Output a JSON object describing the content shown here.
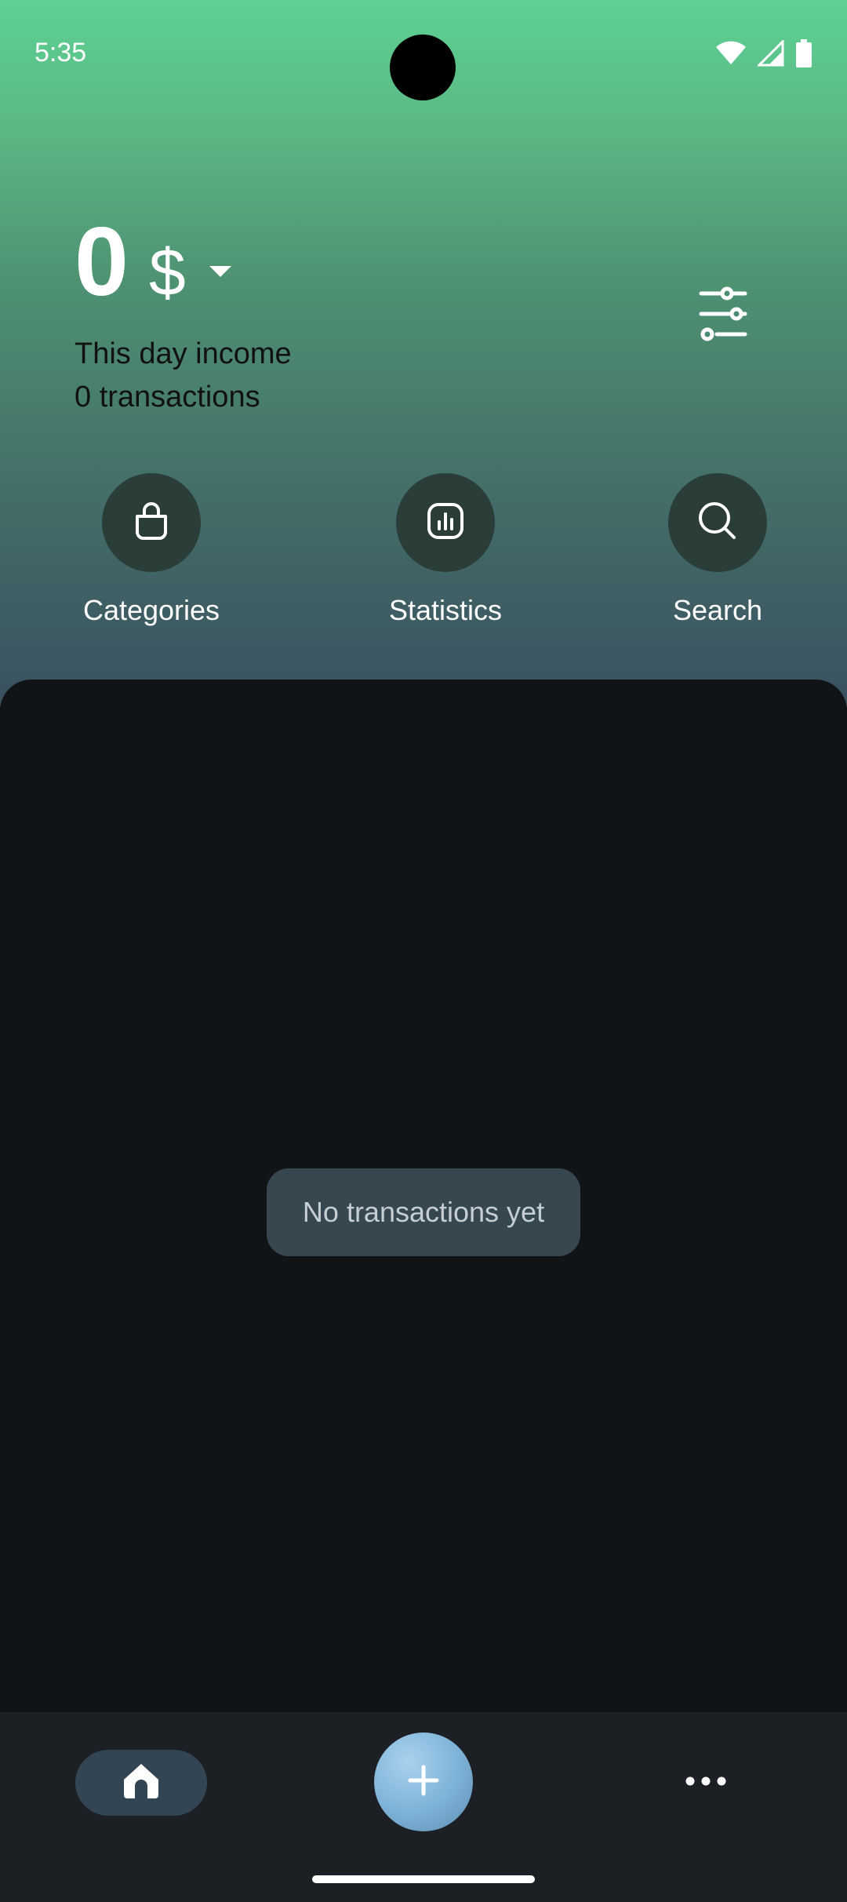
{
  "status_bar": {
    "time": "5:35",
    "icons": [
      "wifi-icon",
      "signal-icon",
      "battery-icon"
    ]
  },
  "summary": {
    "amount": "0",
    "currency": "$",
    "period_label": "This day income",
    "transactions_label": "0 transactions"
  },
  "actions": [
    {
      "label": "Categories",
      "icon": "shopping-bag-icon"
    },
    {
      "label": "Statistics",
      "icon": "chart-icon"
    },
    {
      "label": "Search",
      "icon": "search-icon"
    }
  ],
  "empty_state": {
    "message": "No transactions yet"
  },
  "bottom_nav": {
    "home_icon": "home-icon",
    "add_icon": "plus-icon",
    "more_icon": "more-icon"
  },
  "colors": {
    "header_top": "#5ed193",
    "header_bottom": "#3a5060",
    "background": "#111417",
    "action_circle": "#2b3d38",
    "empty_chip": "#37474f",
    "fab": "#80b4d8",
    "bottom_nav": "#1c1f24"
  }
}
